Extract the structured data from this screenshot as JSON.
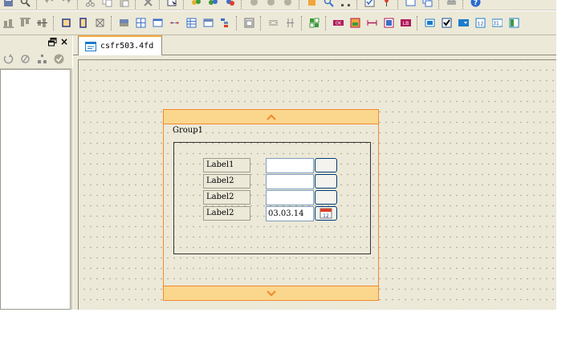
{
  "editor": {
    "tab_title": "csfr503.4fd"
  },
  "form": {
    "group_title": "Group1",
    "rows": [
      {
        "label": "Label1",
        "value": ""
      },
      {
        "label": "Label2",
        "value": ""
      },
      {
        "label": "Label2",
        "value": ""
      },
      {
        "label": "Label2",
        "value": "03.03.14"
      }
    ],
    "calendar_day": "12"
  },
  "colors": {
    "toolbar_bg": "#ece9d8",
    "selection_orange": "#f28a2e",
    "grip_fill": "#fbd68d",
    "input_border": "#7f9db9",
    "help_blue": "#2b6cd0"
  },
  "icons": {
    "panel_close": "×"
  }
}
